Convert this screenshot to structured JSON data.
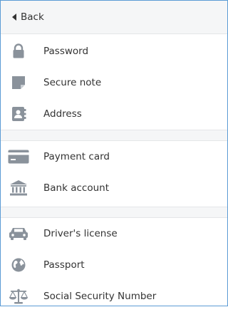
{
  "header": {
    "back_label": "Back"
  },
  "groups": [
    [
      {
        "label": "Password",
        "icon": "lock-icon"
      },
      {
        "label": "Secure note",
        "icon": "note-icon"
      },
      {
        "label": "Address",
        "icon": "address-book-icon"
      }
    ],
    [
      {
        "label": "Payment card",
        "icon": "credit-card-icon"
      },
      {
        "label": "Bank account",
        "icon": "bank-icon"
      }
    ],
    [
      {
        "label": "Driver's license",
        "icon": "car-icon"
      },
      {
        "label": "Passport",
        "icon": "globe-icon"
      },
      {
        "label": "Social Security Number",
        "icon": "scales-icon"
      }
    ]
  ],
  "colors": {
    "icon": "#8a929b",
    "border": "#5b9bd5",
    "header_bg": "#f5f6f7"
  }
}
